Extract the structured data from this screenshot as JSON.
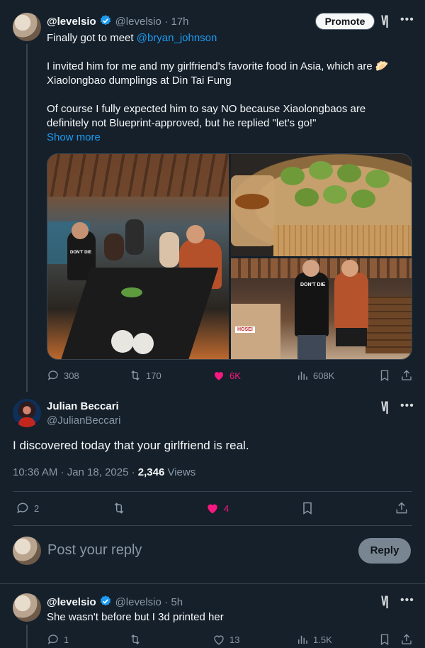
{
  "tweet": {
    "author_name": "@levelsio",
    "author_handle": "@levelsio",
    "time": "· 17h",
    "promote_label": "Promote",
    "line1_prefix": "Finally got to meet ",
    "line1_mention": "@bryan_johnson",
    "para2_line1": "I invited him for me and my girlfriend's favorite food in Asia, which are 🥟",
    "para2_line2": "Xiaolongbao dumplings at Din Tai Fung",
    "para3_line1": "Of course I fully expected him to say NO because Xiaolongbaos are",
    "para3_line2": "definitely not Blueprint-approved, but he replied \"let's go!\"",
    "show_more": "Show more",
    "photo_shirt_text": "DON'T DIE",
    "photo_sign_text": "HOSEI",
    "stats": {
      "replies": "308",
      "reposts": "170",
      "likes": "6K",
      "views": "608K"
    }
  },
  "reply": {
    "author_name": "Julian Beccari",
    "author_handle": "@JulianBeccari",
    "text": "I discovered today that your girlfriend is real.",
    "timestamp": "10:36 AM · Jan 18, 2025 · ",
    "views_count": "2,346",
    "views_label": " Views",
    "stats": {
      "replies": "2",
      "likes": "4"
    }
  },
  "composer": {
    "placeholder": "Post your reply",
    "button_label": "Reply"
  },
  "reply2": {
    "author_name": "@levelsio",
    "author_handle": "@levelsio",
    "time": "· 5h",
    "text": "She wasn't before but I 3d printed her",
    "stats": {
      "replies": "1",
      "likes": "13",
      "views": "1.5K"
    }
  },
  "icons": {
    "grok": "grok-icon",
    "more": "more-icon",
    "verified": "verified-badge-icon",
    "reply": "reply-icon",
    "repost": "repost-icon",
    "like": "like-icon",
    "views": "views-icon",
    "bookmark": "bookmark-icon",
    "share": "share-icon"
  },
  "colors": {
    "background": "#15202b",
    "accent": "#1d9bf0",
    "like": "#f91880",
    "muted": "#8b98a5"
  }
}
